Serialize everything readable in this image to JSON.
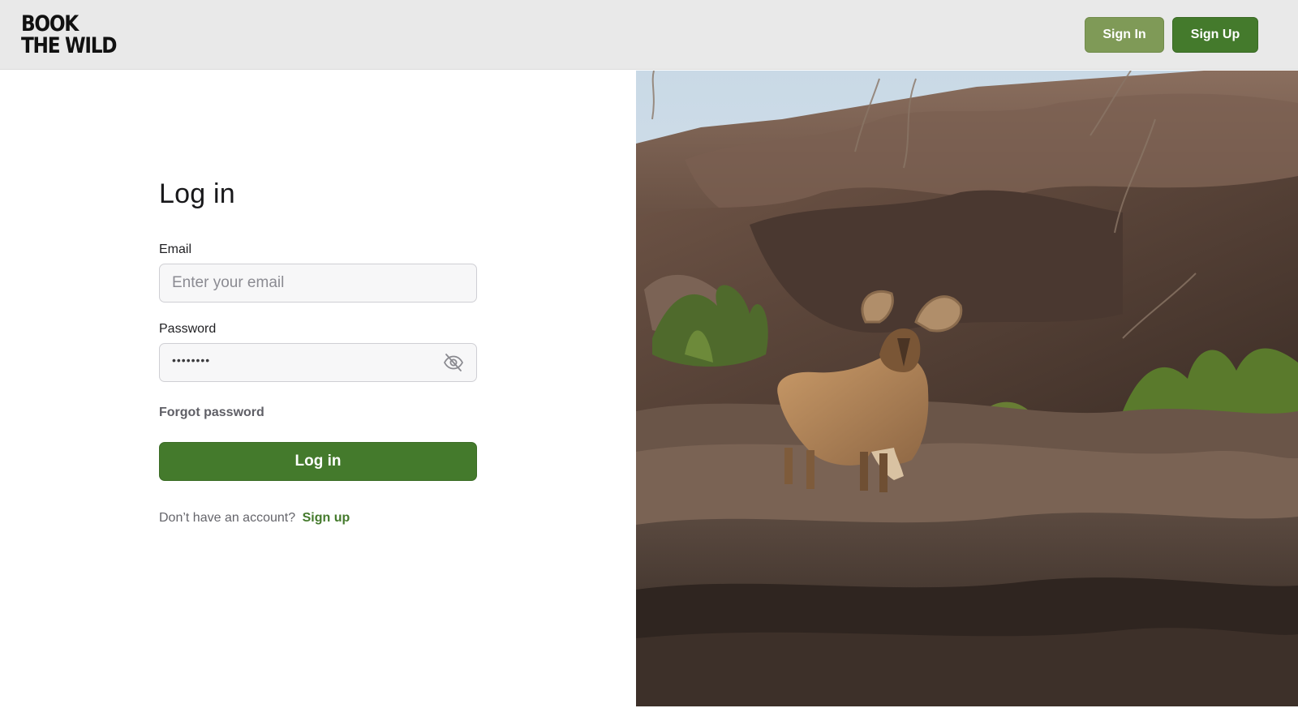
{
  "header": {
    "logo_line1": "BOOK",
    "logo_line2": "THE WILD",
    "sign_in_label": "Sign In",
    "sign_up_label": "Sign Up"
  },
  "login": {
    "title": "Log in",
    "email_label": "Email",
    "email_placeholder": "Enter your email",
    "email_value": "",
    "password_label": "Password",
    "password_mask": "••••••••",
    "toggle_icon": "eye-off-icon",
    "forgot_label": "Forgot password",
    "submit_label": "Log in",
    "no_account_text": "Don’t have an account?",
    "signup_link_label": "Sign up"
  },
  "colors": {
    "brand_green": "#447a2c",
    "muted_green": "#7f9a57",
    "header_bg": "#e9e9e9"
  },
  "hero_image": {
    "icon": "aoudad-ram-on-rocks-photo"
  }
}
